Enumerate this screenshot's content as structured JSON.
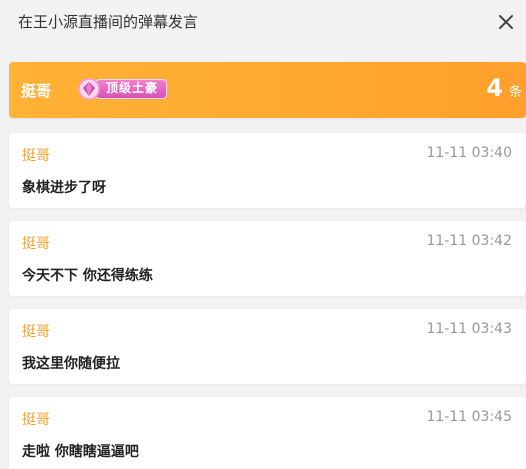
{
  "header": {
    "title": "在王小源直播间的弹幕发言",
    "close_icon": "close-icon"
  },
  "summary": {
    "username": "挺哥",
    "badge_label": "顶级土豪",
    "badge_icon": "gem-icon",
    "count": "4",
    "count_unit": "条"
  },
  "colors": {
    "accent_orange": "#ffa930",
    "username_color": "#f0a030",
    "badge_pink": "#d653b4"
  },
  "messages": [
    {
      "name": "挺哥",
      "time": "11-11 03:40",
      "text": "象棋进步了呀"
    },
    {
      "name": "挺哥",
      "time": "11-11 03:42",
      "text": "今天不下 你还得练练"
    },
    {
      "name": "挺哥",
      "time": "11-11 03:43",
      "text": "我这里你随便拉"
    },
    {
      "name": "挺哥",
      "time": "11-11 03:45",
      "text": "走啦 你瞎瞎逼逼吧"
    }
  ]
}
